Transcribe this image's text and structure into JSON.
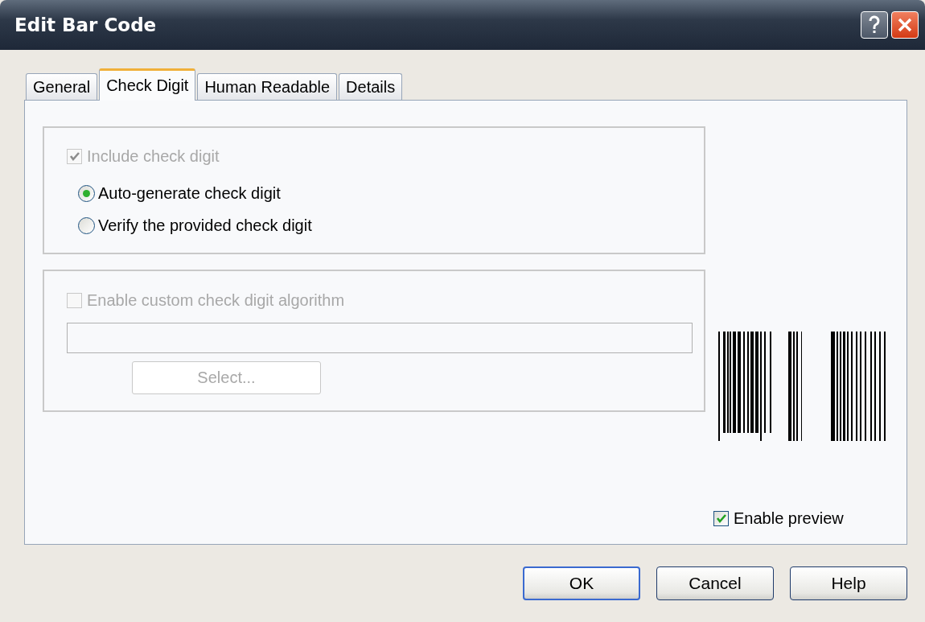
{
  "window": {
    "title": "Edit Bar Code"
  },
  "tabs": [
    {
      "label": "General",
      "selected": false
    },
    {
      "label": "Check Digit",
      "selected": true
    },
    {
      "label": "Human Readable",
      "selected": false
    },
    {
      "label": "Details",
      "selected": false
    }
  ],
  "check_digit_group": {
    "include": {
      "label": "Include check digit",
      "checked": true,
      "disabled": true
    },
    "options": [
      {
        "label": "Auto-generate check digit",
        "selected": true
      },
      {
        "label": "Verify the provided check digit",
        "selected": false
      }
    ]
  },
  "custom_algorithm_group": {
    "enable": {
      "label": "Enable custom check digit algorithm",
      "checked": false,
      "disabled": true
    },
    "field": {
      "disabled": true
    },
    "select_button": {
      "label": "Select...",
      "disabled": true
    }
  },
  "preview": {
    "enable": {
      "label": "Enable preview",
      "checked": true,
      "disabled": false
    }
  },
  "buttons": [
    {
      "label": "OK",
      "default": true
    },
    {
      "label": "Cancel",
      "default": false
    },
    {
      "label": "Help",
      "default": false
    }
  ]
}
